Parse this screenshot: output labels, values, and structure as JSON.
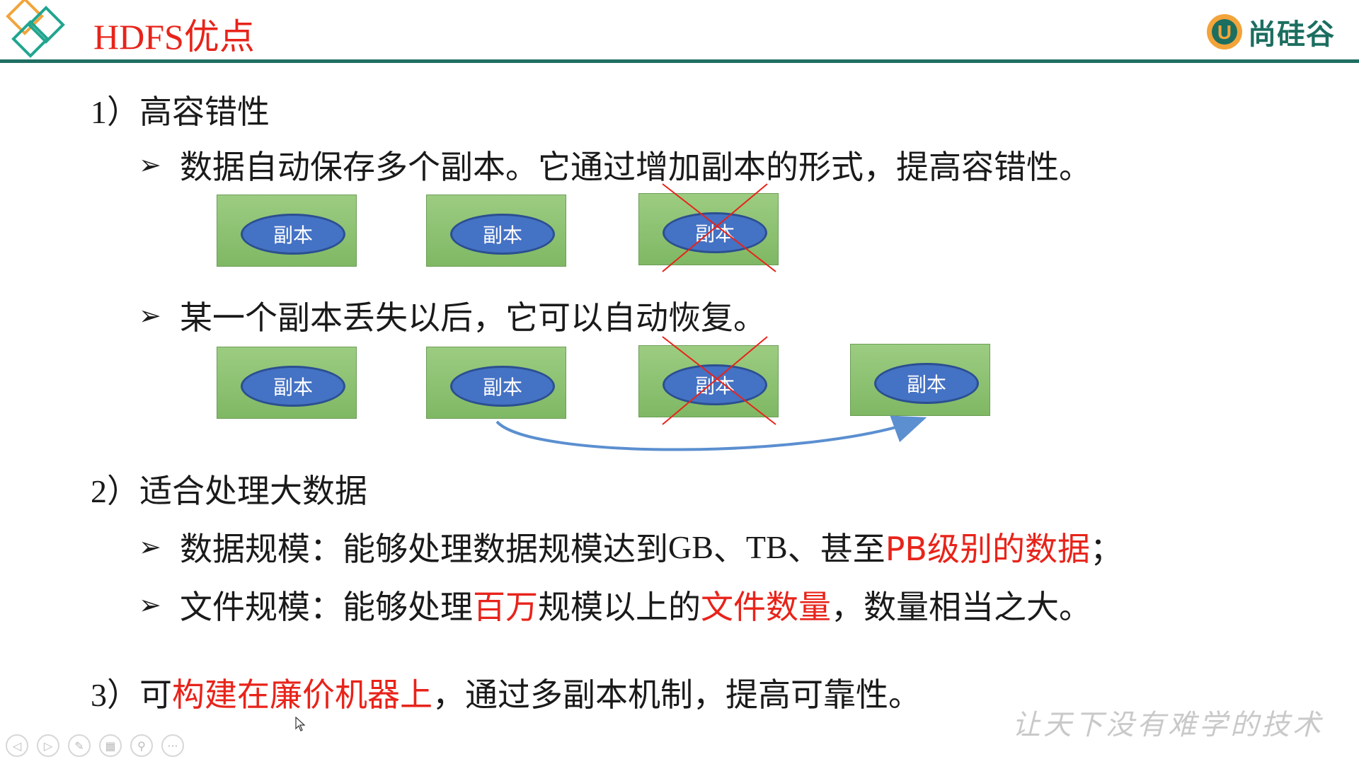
{
  "header": {
    "title": "HDFS优点",
    "brand": "尚硅谷",
    "brand_mark": "U",
    "logo_icon": "diamond-logo-icon",
    "brand_icon": "u-brand-icon"
  },
  "colors": {
    "accent_red": "#e8231a",
    "rule_green": "#1f6f63",
    "node_green": "#8cc26f",
    "oval_blue": "#4472c4",
    "arrow_blue": "#5b8fd0",
    "cross_red": "#e8231a"
  },
  "sections": [
    {
      "number": "1）",
      "heading": "高容错性",
      "bullets": [
        "数据自动保存多个副本。它通过增加副本的形式，提高容错性。",
        "某一个副本丢失以后，它可以自动恢复。"
      ]
    },
    {
      "number": "2）",
      "heading": "适合处理大数据",
      "bullet1": {
        "p1": "数据规模：能够处理数据规模达到",
        "p2": "GB",
        "p3": "、",
        "p4": "TB",
        "p5": "、甚至",
        "p6": "PB级别的数据",
        "p7": "；"
      },
      "bullet2": {
        "p1": "文件规模：能够处理",
        "p2": "百万",
        "p3": "规模以上的",
        "p4": "文件数量",
        "p5": "，数量相当之大。"
      }
    },
    {
      "number": "3）",
      "p1": "可",
      "p2": "构建在廉价机器上",
      "p3": "，通过多副本机制，提高可靠性。"
    }
  ],
  "diagram": {
    "row1": [
      {
        "label": "副本",
        "lost": false
      },
      {
        "label": "副本",
        "lost": false
      },
      {
        "label": "副本",
        "lost": true
      }
    ],
    "row2": [
      {
        "label": "副本",
        "lost": false
      },
      {
        "label": "副本",
        "lost": false
      },
      {
        "label": "副本",
        "lost": true
      },
      {
        "label": "副本",
        "lost": false
      }
    ]
  },
  "footer": {
    "slogan": "让天下没有难学的技术"
  },
  "toolbar": {
    "buttons": [
      "previous-icon",
      "next-icon",
      "pen-icon",
      "slides-icon",
      "zoom-icon",
      "more-icon"
    ],
    "glyphs": [
      "◁",
      "▷",
      "✎",
      "▦",
      "⚲",
      "···"
    ]
  }
}
